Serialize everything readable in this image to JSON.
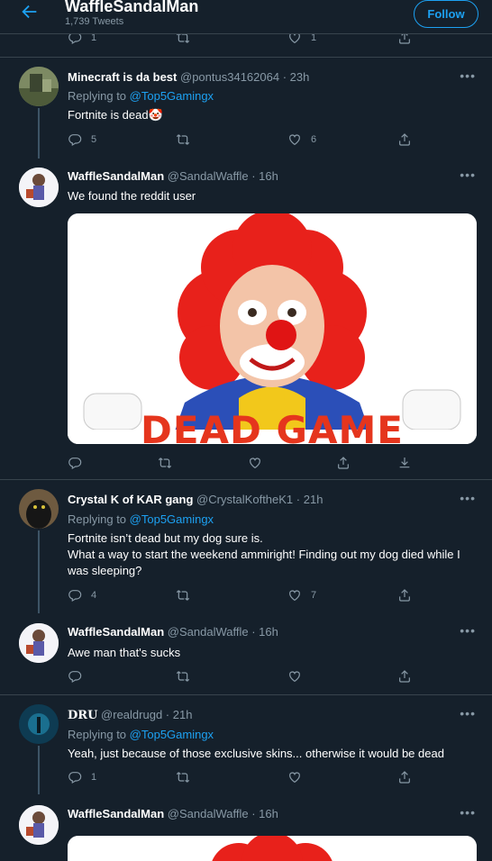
{
  "header": {
    "title": "WaffleSandalMan",
    "tweet_count": "1,739 Tweets",
    "follow_label": "Follow",
    "prev_actions": {
      "replies": "1",
      "likes": "1"
    }
  },
  "tweets": [
    {
      "name": "Minecraft is da best",
      "handle": "@pontus34162064",
      "time": "23h",
      "replying_prefix": "Replying to ",
      "replying_to": "@Top5Gamingx",
      "text": "Fortnite is dead🤡",
      "replies": "5",
      "likes": "6"
    },
    {
      "name": "WaffleSandalMan",
      "handle": "@SandalWaffle",
      "time": "16h",
      "text": "We found the reddit user",
      "image_caption": "DEAD GAME"
    },
    {
      "name": "Crystal K of KAR gang",
      "handle": "@CrystalKoftheK1",
      "time": "21h",
      "replying_prefix": "Replying to ",
      "replying_to": "@Top5Gamingx",
      "text_line1": "Fortnite isn’t dead but my dog sure is.",
      "text_line2": "What a way to start the weekend ammiright! Finding out my dog died while I was sleeping?",
      "replies": "4",
      "likes": "7"
    },
    {
      "name": "WaffleSandalMan",
      "handle": "@SandalWaffle",
      "time": "16h",
      "text": "Awe man that's sucks"
    },
    {
      "name": "DRU",
      "handle": "@realdrugd",
      "time": "21h",
      "replying_prefix": "Replying to ",
      "replying_to": "@Top5Gamingx",
      "text": "Yeah, just because of those exclusive skins... otherwise it would be dead",
      "replies": "1"
    },
    {
      "name": "WaffleSandalMan",
      "handle": "@SandalWaffle",
      "time": "16h"
    }
  ],
  "more_glyph": "•••",
  "dot_sep": " · ",
  "colors": {
    "bg": "#15202b",
    "accent": "#1da1f2",
    "muted": "#8899a6",
    "border": "#38444d"
  }
}
